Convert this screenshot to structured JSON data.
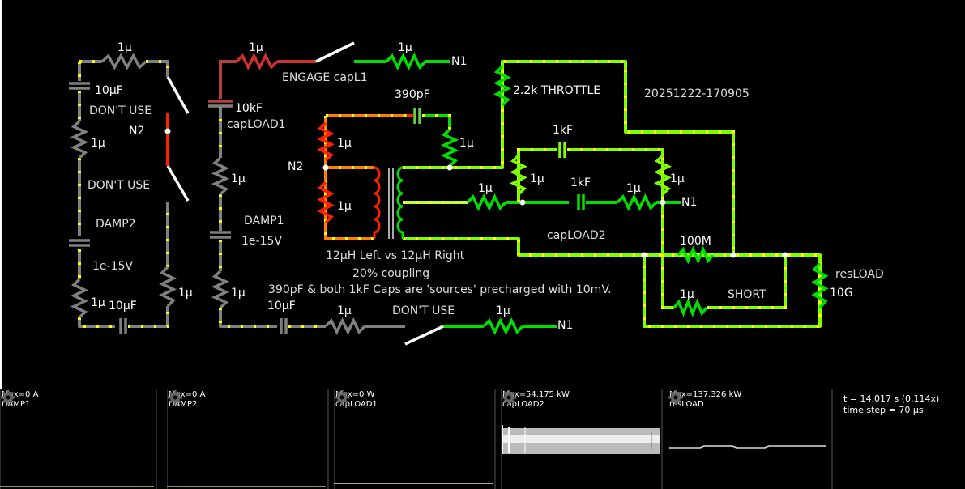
{
  "labels": {
    "top_left_res": "1µ",
    "cap_10uF_a": "10µF",
    "dont_use_1": "DON'T USE",
    "n2_left": "N2",
    "res_left_mid": "1µ",
    "dont_use_2": "DON'T USE",
    "damp2": "DAMP2",
    "v_1e15_left": "1e-15V",
    "res_left_low": "1µ",
    "cap_10uF_b": "10µF",
    "res_left_right": "1µ",
    "res_engage": "1µ",
    "engage": "ENGAGE capL1",
    "res_n1_top": "1µ",
    "n1_top": "N1",
    "cap_10kF": "10kF",
    "caploAD1": "capLOAD1",
    "res_damp1": "1µ",
    "damp1": "DAMP1",
    "v_1e15_mid": "1e-15V",
    "res_damp1_low": "1µ",
    "cap_10uF_c": "10µF",
    "res_bottom_mid": "1µ",
    "dont_use_3": "DON'T USE",
    "res_n1_bottom": "1µ",
    "n1_bottom": "N1",
    "cap_390pF": "390pF",
    "res_red_top": "1µ",
    "res_green_390": "1µ",
    "n2_mid": "N2",
    "res_red_bottom": "1µ",
    "inductor_note": "12µH Left vs 12µH Right",
    "coupling_note": "20% coupling",
    "caps_note": "390pF & both 1kF Caps are 'sources' precharged with 10mV.",
    "throttle": "2.2k THROTTLE",
    "timestamp": "20251222-170905",
    "cap_1kF_top": "1kF",
    "res_1u_a": "1µ",
    "res_1u_b": "1µ",
    "res_1u_c": "1µ",
    "cap_1kF_mid": "1kF",
    "res_1u_d": "1µ",
    "n1_right": "N1",
    "caploAD2": "capLOAD2",
    "res_100M": "100M",
    "res_1u_short": "1µ",
    "short": "SHORT",
    "resload": "resLOAD",
    "res_10G": "10G"
  },
  "scopes": [
    {
      "max": "Max=0 A",
      "name": "DAMP1"
    },
    {
      "max": "Max=0 A",
      "name": "DAMP2"
    },
    {
      "max": "Max=0 W",
      "name": "capLOAD1"
    },
    {
      "max": "Max=54.175 kW",
      "name": "capLOAD2"
    },
    {
      "max": "Max=137.326 kW",
      "name": "resLOAD"
    }
  ],
  "status": {
    "time": "t = 14.017 s (0.114x)",
    "step": "time step = 70 µs"
  },
  "colors": {
    "green": "#00e000",
    "lime": "#80ff00",
    "gray": "#808080",
    "red": "#ff2000",
    "orange": "#ff8000",
    "dot": "#ffff00"
  }
}
